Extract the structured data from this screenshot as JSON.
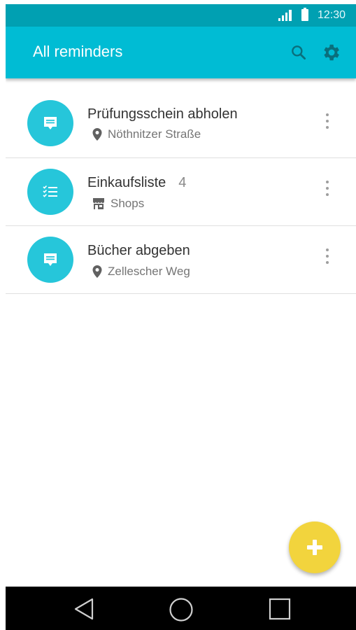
{
  "status_bar": {
    "time": "12:30",
    "icons": [
      "signal-icon",
      "battery-icon"
    ]
  },
  "app_bar": {
    "title": "All reminders",
    "icons": [
      "search-icon",
      "settings-gear-icon"
    ]
  },
  "reminders": [
    {
      "title": "Prüfungsschein abholen",
      "subtitle": "Nöthnitzer Straße",
      "type_icon": "note-icon",
      "sub_icon": "location-pin-icon",
      "count": ""
    },
    {
      "title": "Einkaufsliste",
      "count": "4",
      "subtitle": "Shops",
      "type_icon": "checklist-icon",
      "sub_icon": "store-icon"
    },
    {
      "title": "Bücher abgeben",
      "subtitle": "Zellescher Weg",
      "type_icon": "note-icon",
      "sub_icon": "location-pin-icon",
      "count": ""
    }
  ],
  "fab": {
    "icon": "plus-icon"
  },
  "nav_bar": {
    "icons": [
      "back-icon",
      "home-icon",
      "recents-icon"
    ]
  },
  "colors": {
    "accent": "#00bcd4",
    "status_bar": "#00a0b2",
    "avatar": "#26c6da",
    "fab": "#f2d43d"
  }
}
